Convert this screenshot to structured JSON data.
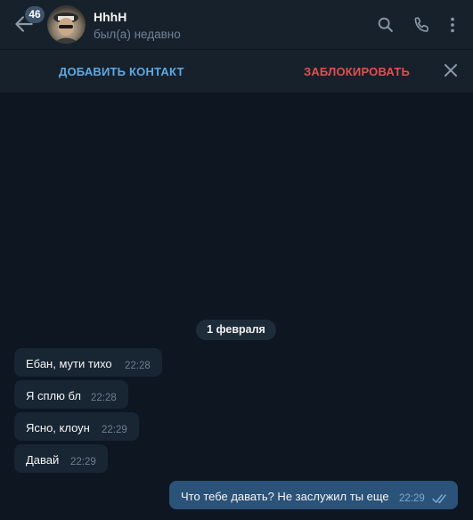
{
  "header": {
    "unread_badge": "46",
    "title": "HhhH",
    "status": "был(а) недавно",
    "icons": [
      "back-arrow-icon",
      "search-icon",
      "phone-icon",
      "more-vert-icon"
    ]
  },
  "action_bar": {
    "add_contact": "ДОБАВИТЬ КОНТАКТ",
    "block": "ЗАБЛОКИРОВАТЬ",
    "close_icon": "close-icon"
  },
  "chat": {
    "date_separator": "1 февраля",
    "incoming": [
      {
        "text": "Ебан, мути тихо",
        "time": "22:28"
      },
      {
        "text": "Я сплю бл",
        "time": "22:28"
      },
      {
        "text": "Ясно, клоун",
        "time": "22:29"
      },
      {
        "text": "Давай",
        "time": "22:29"
      }
    ],
    "outgoing": [
      {
        "text": "Что тебе давать? Не заслужил ты еще",
        "time": "22:29",
        "status_icon": "double-check-icon"
      }
    ]
  },
  "colors": {
    "background": "#0e1621",
    "header": "#17212b",
    "incoming_bubble": "#182533",
    "outgoing_bubble": "#2b5278",
    "accent_blue": "#5fa8e3",
    "danger_red": "#e2504e",
    "secondary_text": "#708499"
  }
}
